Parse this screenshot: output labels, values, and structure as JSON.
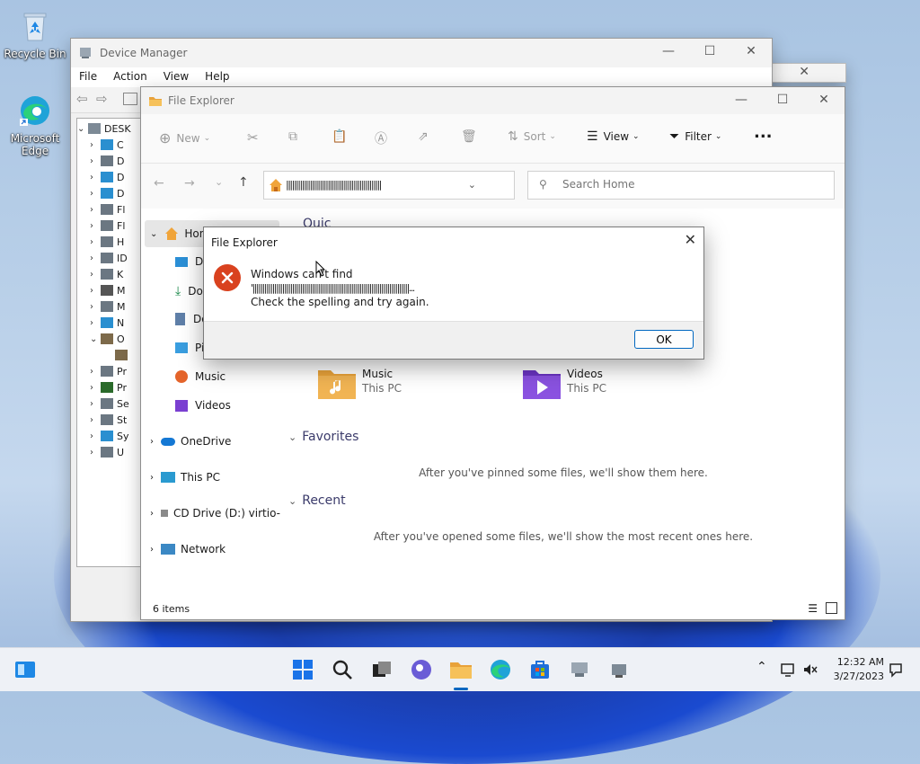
{
  "desktop": {
    "icons": [
      {
        "label": "Recycle Bin"
      },
      {
        "label_line1": "Microsoft",
        "label_line2": "Edge"
      }
    ]
  },
  "device_manager": {
    "title": "Device Manager",
    "menu": [
      "File",
      "Action",
      "View",
      "Help"
    ],
    "root_label": "DESK",
    "rows": [
      "C",
      "D",
      "D",
      "D",
      "Fl",
      "Fl",
      "H",
      "ID",
      "K",
      "M",
      "M",
      "N",
      "O",
      "",
      "Pr",
      "Pr",
      "Se",
      "St",
      "Sy",
      "U"
    ]
  },
  "file_explorer": {
    "title": "File Explorer",
    "toolbar": {
      "new_label": "New",
      "sort_label": "Sort",
      "view_label": "View",
      "filter_label": "Filter",
      "more_label": "..."
    },
    "address_text": "||||||||||||||||||||||||||||||||||||||||||||||||",
    "search_placeholder": "Search Home",
    "nav": {
      "home": "Hon",
      "desktop": "De",
      "downloads": "Do",
      "documents": "Do",
      "pictures": "Pi",
      "music": "Music",
      "videos": "Videos",
      "onedrive": "OneDrive",
      "this_pc": "This PC",
      "cd_drive": "CD Drive (D:) virtio-",
      "network": "Network"
    },
    "quick_access_partial": "Quic",
    "quick_items": [
      {
        "name": "Music",
        "location": "This PC"
      },
      {
        "name": "Videos",
        "location": "This PC"
      }
    ],
    "favorites": {
      "heading": "Favorites",
      "empty": "After you've pinned some files, we'll show them here."
    },
    "recent": {
      "heading": "Recent",
      "empty": "After you've opened some files, we'll show the most recent ones here."
    },
    "status": "6 items"
  },
  "dialog": {
    "title": "File Explorer",
    "line1": "Windows can't find",
    "line2": "'|||||||||||||||||||||||||||||||||||||||||||||||||||||||||||||||||||||||||||||||...",
    "line3": "Check the spelling and try again.",
    "ok_label": "OK"
  },
  "taskbar": {
    "time": "12:32 AM",
    "date": "3/27/2023"
  },
  "colors": {
    "accent": "#0067c0",
    "error": "#d9421f",
    "folder": "#e8a23a"
  }
}
